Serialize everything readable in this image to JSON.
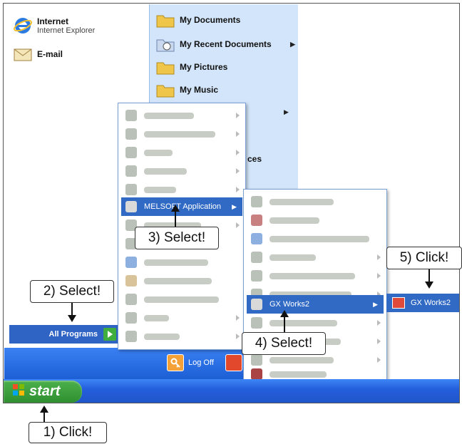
{
  "start_menu": {
    "pinned": [
      {
        "label": "Internet",
        "sub": "Internet Explorer",
        "icon": "internet-explorer-icon"
      },
      {
        "label": "E-mail",
        "icon": "email-icon"
      }
    ],
    "places": [
      {
        "label": "My Documents",
        "icon": "folder-icon"
      },
      {
        "label": "My Recent Documents",
        "icon": "folder-icon"
      },
      {
        "label": "My Pictures",
        "icon": "folder-icon"
      },
      {
        "label": "My Music",
        "icon": "folder-icon"
      }
    ],
    "partial_text": "ces",
    "all_programs": "All Programs",
    "log_off": "Log Off",
    "start": "start"
  },
  "programs_menu": {
    "selected": "MELSOFT Application"
  },
  "melsoft_menu": {
    "selected": "GX Works2"
  },
  "gxworks_menu": {
    "item": "GX Works2"
  },
  "callouts": {
    "step1": "1) Click!",
    "step2": "2) Select!",
    "step3": "3) Select!",
    "step4": "4) Select!",
    "step5": "5) Click!"
  }
}
